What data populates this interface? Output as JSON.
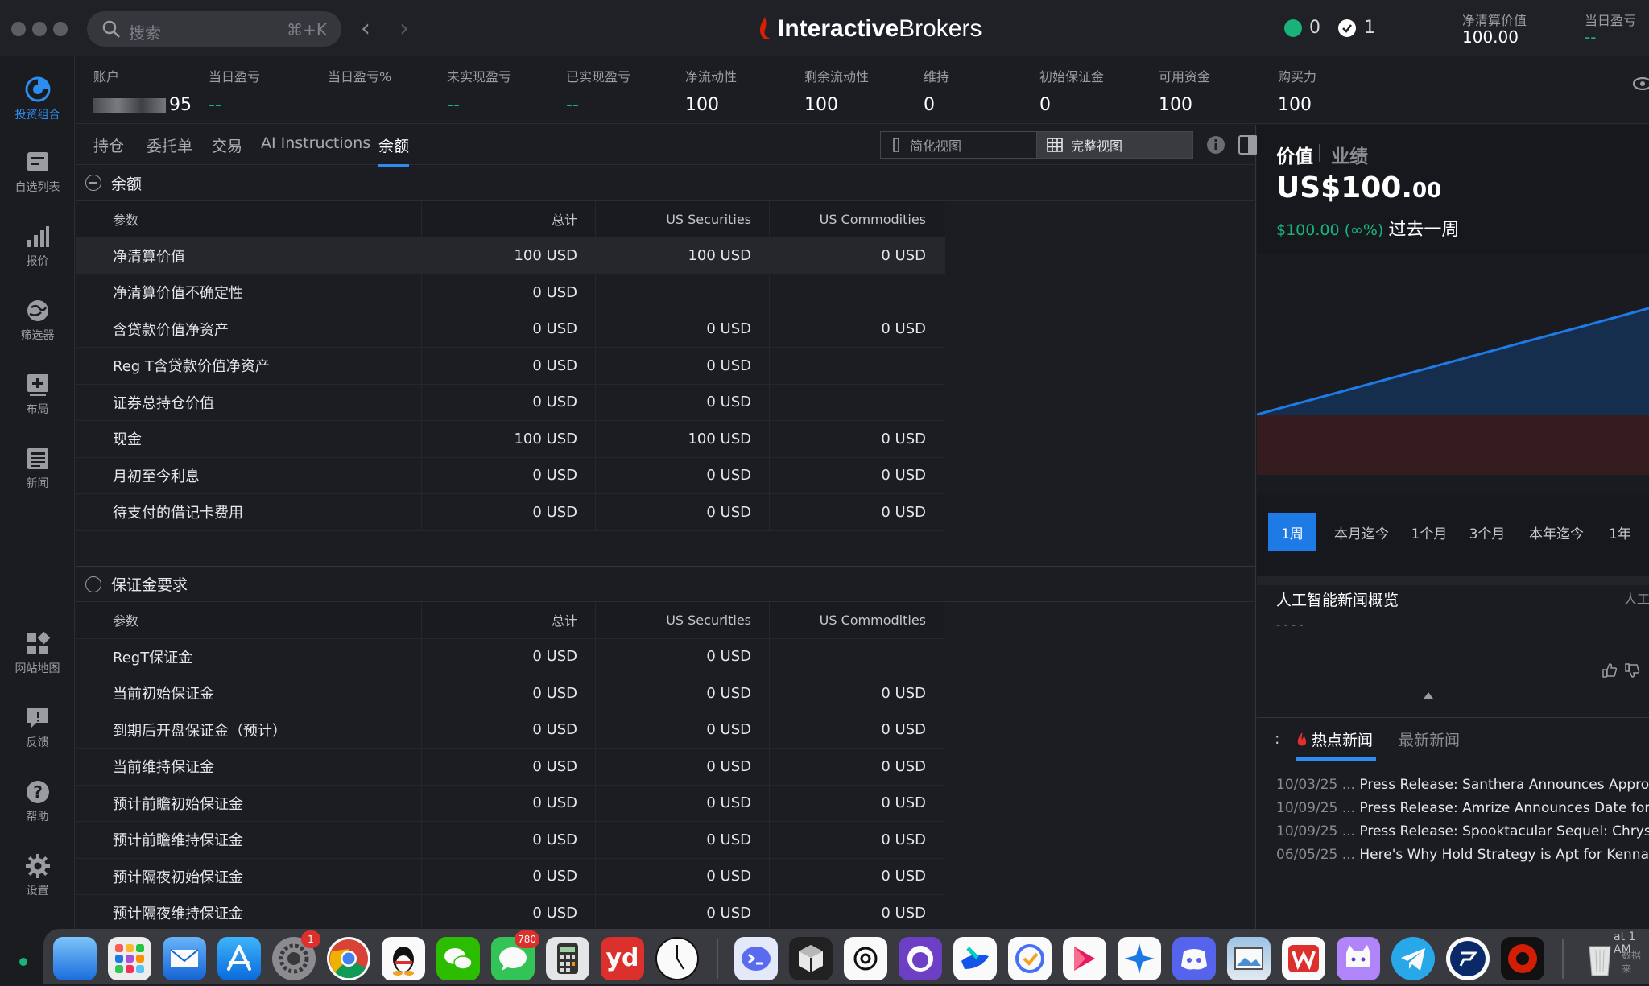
{
  "titlebar": {
    "search_placeholder": "搜索",
    "search_shortcut": "⌘+K",
    "brand_bold": "Interactive",
    "brand_light": "Brokers",
    "status_green_count": "0",
    "status_check_count": "1",
    "nlv_label": "净清算价值",
    "nlv_value": "100.00",
    "daily_pnl_label": "当日盈亏",
    "daily_pnl_value": "--"
  },
  "sidebar": {
    "items": [
      {
        "label": "投资组合",
        "icon": "portfolio-icon",
        "active": true
      },
      {
        "label": "自选列表",
        "icon": "watchlist-icon"
      },
      {
        "label": "报价",
        "icon": "quotes-icon"
      },
      {
        "label": "筛选器",
        "icon": "screener-icon"
      },
      {
        "label": "布局",
        "icon": "layout-icon"
      },
      {
        "label": "新闻",
        "icon": "news-icon"
      },
      {
        "label": "网站地图",
        "icon": "sitemap-icon"
      },
      {
        "label": "反馈",
        "icon": "feedback-icon"
      },
      {
        "label": "帮助",
        "icon": "help-icon"
      },
      {
        "label": "设置",
        "icon": "settings-icon"
      }
    ]
  },
  "account_bar": [
    {
      "label": "账户",
      "value": "95"
    },
    {
      "label": "当日盈亏",
      "value": "--"
    },
    {
      "label": "当日盈亏%",
      "value": ""
    },
    {
      "label": "未实现盈亏",
      "value": "--"
    },
    {
      "label": "已实现盈亏",
      "value": "--"
    },
    {
      "label": "净流动性",
      "value": "100"
    },
    {
      "label": "剩余流动性",
      "value": "100"
    },
    {
      "label": "维持",
      "value": "0"
    },
    {
      "label": "初始保证金",
      "value": "0"
    },
    {
      "label": "可用资金",
      "value": "100"
    },
    {
      "label": "购买力",
      "value": "100"
    }
  ],
  "tabs": [
    "持仓",
    "委托单",
    "交易",
    "AI Instructions",
    "余额"
  ],
  "active_tab": "余额",
  "view_buttons": {
    "simple": "简化视图",
    "full": "完整视图"
  },
  "balances": {
    "title": "余额",
    "headers": [
      "参数",
      "总计",
      "US Securities",
      "US Commodities"
    ],
    "rows": [
      [
        "净清算价值",
        "100 USD",
        "100 USD",
        "0 USD"
      ],
      [
        "净清算价值不确定性",
        "0 USD",
        "",
        ""
      ],
      [
        "含贷款价值净资产",
        "0 USD",
        "0 USD",
        "0 USD"
      ],
      [
        "Reg T含贷款价值净资产",
        "0 USD",
        "0 USD",
        ""
      ],
      [
        "证券总持仓价值",
        "0 USD",
        "0 USD",
        ""
      ],
      [
        "现金",
        "100 USD",
        "100 USD",
        "0 USD"
      ],
      [
        "月初至今利息",
        "0 USD",
        "0 USD",
        "0 USD"
      ],
      [
        "待支付的借记卡费用",
        "0 USD",
        "0 USD",
        "0 USD"
      ]
    ]
  },
  "margin": {
    "title": "保证金要求",
    "headers": [
      "参数",
      "总计",
      "US Securities",
      "US Commodities"
    ],
    "rows": [
      [
        "RegT保证金",
        "0 USD",
        "0 USD",
        ""
      ],
      [
        "当前初始保证金",
        "0 USD",
        "0 USD",
        "0 USD"
      ],
      [
        "到期后开盘保证金（预计）",
        "0 USD",
        "0 USD",
        "0 USD"
      ],
      [
        "当前维持保证金",
        "0 USD",
        "0 USD",
        "0 USD"
      ],
      [
        "预计前瞻初始保证金",
        "0 USD",
        "0 USD",
        "0 USD"
      ],
      [
        "预计前瞻维持保证金",
        "0 USD",
        "0 USD",
        "0 USD"
      ],
      [
        "预计隔夜初始保证金",
        "0 USD",
        "0 USD",
        "0 USD"
      ],
      [
        "预计隔夜维持保证金",
        "0 USD",
        "0 USD",
        "0 USD"
      ]
    ]
  },
  "right_panel": {
    "tab_value": "价值",
    "tab_performance": "业绩",
    "value_main": "US$100.",
    "value_cents": "00",
    "change": "$100.00 (∞%)",
    "change_period": "过去一周",
    "ranges": [
      "1周",
      "本月迄今",
      "1个月",
      "3个月",
      "本年迄今",
      "1年"
    ],
    "active_range": "1周",
    "ai_title": "人工智能新闻概览",
    "ai_right": "人工智",
    "ai_dash": "- - - -",
    "news_prefix": ":",
    "news_tabs": [
      "热点新闻",
      "最新新闻"
    ],
    "news": [
      {
        "date": "10/03/25 ...",
        "text": "Press Release: Santhera Announces Approva"
      },
      {
        "date": "10/09/25 ...",
        "text": "Press Release: Amrize Announces Date for T"
      },
      {
        "date": "10/09/25 ...",
        "text": "Press Release: Spooktacular Sequel: Chrysle"
      },
      {
        "date": "06/05/25 ...",
        "text": "Here's Why Hold Strategy is Apt for Kennam"
      }
    ],
    "news_tail": "at 1 AM",
    "data_source_partial": "数据来"
  },
  "dock": {
    "badges": {
      "settings": "1",
      "messages": "780"
    },
    "yd_label": "yd"
  },
  "colors": {
    "accent": "#2d8cf0",
    "positive": "#19b37a",
    "ib_red": "#d81e05",
    "chart_line": "#1e7be6"
  }
}
